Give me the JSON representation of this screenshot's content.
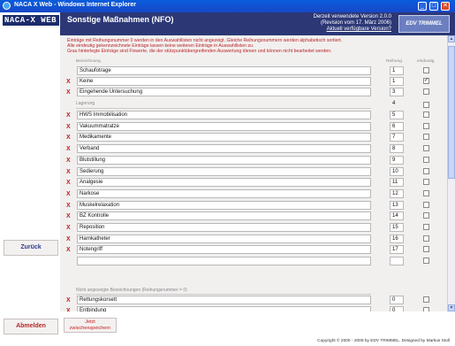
{
  "window": {
    "title": "NACA X Web - Windows Internet Explorer",
    "btn_min": "_",
    "btn_max": "□",
    "btn_close": "✕"
  },
  "nav": {
    "logo": "NACA-X WEB",
    "back_label": "Zurück",
    "logout_label": "Abmelden"
  },
  "header": {
    "title": "Sonstige Maßnahmen (NFO)",
    "version_line1": "Derzeit verwendete Version 2.0.0",
    "version_line2": "(Revision vom 17. März 2006)",
    "version_line3": "Aktuell verfügbare Version?",
    "brand": "EDV TRIMMEL"
  },
  "notice": [
    "Einträge mit Reihungsnummer 0 werden in den Auswahllisten nicht angezeigt. Gleiche Reihungsnummern werden alphabetisch sortiert.",
    "Alle eindeutig gekennzeichnete Einträge lassen keine weiteren Einträge in Auswahllisten zu.",
    "Grau hinterlegte Einträge sind Fixwerte, die der stützpunktübergreifenden Auswertung dienen und können nicht bearbeitet werden."
  ],
  "columns": {
    "name": "Bezeichnung",
    "order": "Reihung",
    "exclusive": "eindeutig"
  },
  "section1_rows": [
    {
      "x": "",
      "name": "Schaufotrage",
      "order": "1",
      "checked": ""
    },
    {
      "x": "X",
      "name": "Keine",
      "order": "1",
      "checked": "✓"
    },
    {
      "x": "X",
      "name": "Eingehende Untersuchung",
      "order": "3",
      "checked": ""
    }
  ],
  "section2_header": "Lagerung",
  "section2_header_order": "4",
  "section2_rows": [
    {
      "x": "X",
      "name": "HWS Immobilisation",
      "order": "5",
      "checked": ""
    },
    {
      "x": "X",
      "name": "Vakuummatratze",
      "order": "6",
      "checked": ""
    },
    {
      "x": "X",
      "name": "Medikamente",
      "order": "7",
      "checked": ""
    },
    {
      "x": "X",
      "name": "Verband",
      "order": "8",
      "checked": ""
    },
    {
      "x": "X",
      "name": "Blutstillung",
      "order": "9",
      "checked": ""
    },
    {
      "x": "X",
      "name": "Sedierung",
      "order": "10",
      "checked": ""
    },
    {
      "x": "X",
      "name": "Analgesie",
      "order": "11",
      "checked": ""
    },
    {
      "x": "X",
      "name": "Narkose",
      "order": "12",
      "checked": ""
    },
    {
      "x": "X",
      "name": "Muskelrelaxation",
      "order": "13",
      "checked": ""
    },
    {
      "x": "X",
      "name": "BZ Kontrolle",
      "order": "14",
      "checked": ""
    },
    {
      "x": "X",
      "name": "Reposition",
      "order": "15",
      "checked": ""
    },
    {
      "x": "X",
      "name": "Harnkatheter",
      "order": "16",
      "checked": ""
    },
    {
      "x": "X",
      "name": "Notengriff",
      "order": "17",
      "checked": ""
    },
    {
      "x": "",
      "name": "",
      "order": "",
      "checked": ""
    }
  ],
  "section3_header": "Nicht angezeigte Bezeichnungen (Reihungsnummer = 0)",
  "section3_rows": [
    {
      "x": "X",
      "name": "Rettungskorsett",
      "order": "0",
      "checked": ""
    },
    {
      "x": "X",
      "name": "Entbindung",
      "order": "0",
      "checked": ""
    }
  ],
  "footer": {
    "save_line1": "Jetzt",
    "save_line2": "zwischenspeichern",
    "copyright": "Copyright © 2000 - 2009 by EDV TRIMMEL. Designed by Markus Stoll"
  },
  "colors": {
    "header_bg": "#2c3876",
    "content_bg": "#f2f0ef",
    "delete_red": "#c22020"
  }
}
